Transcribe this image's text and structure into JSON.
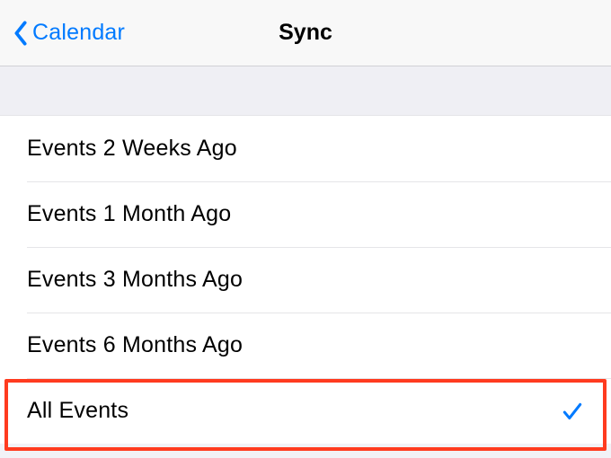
{
  "nav": {
    "back_label": "Calendar",
    "title": "Sync"
  },
  "options": [
    {
      "label": "Events 2 Weeks Ago",
      "selected": false
    },
    {
      "label": "Events 1 Month Ago",
      "selected": false
    },
    {
      "label": "Events 3 Months Ago",
      "selected": false
    },
    {
      "label": "Events 6 Months Ago",
      "selected": false
    },
    {
      "label": "All Events",
      "selected": true
    }
  ],
  "colors": {
    "accent": "#007aff",
    "highlight": "#ff3b1f"
  }
}
